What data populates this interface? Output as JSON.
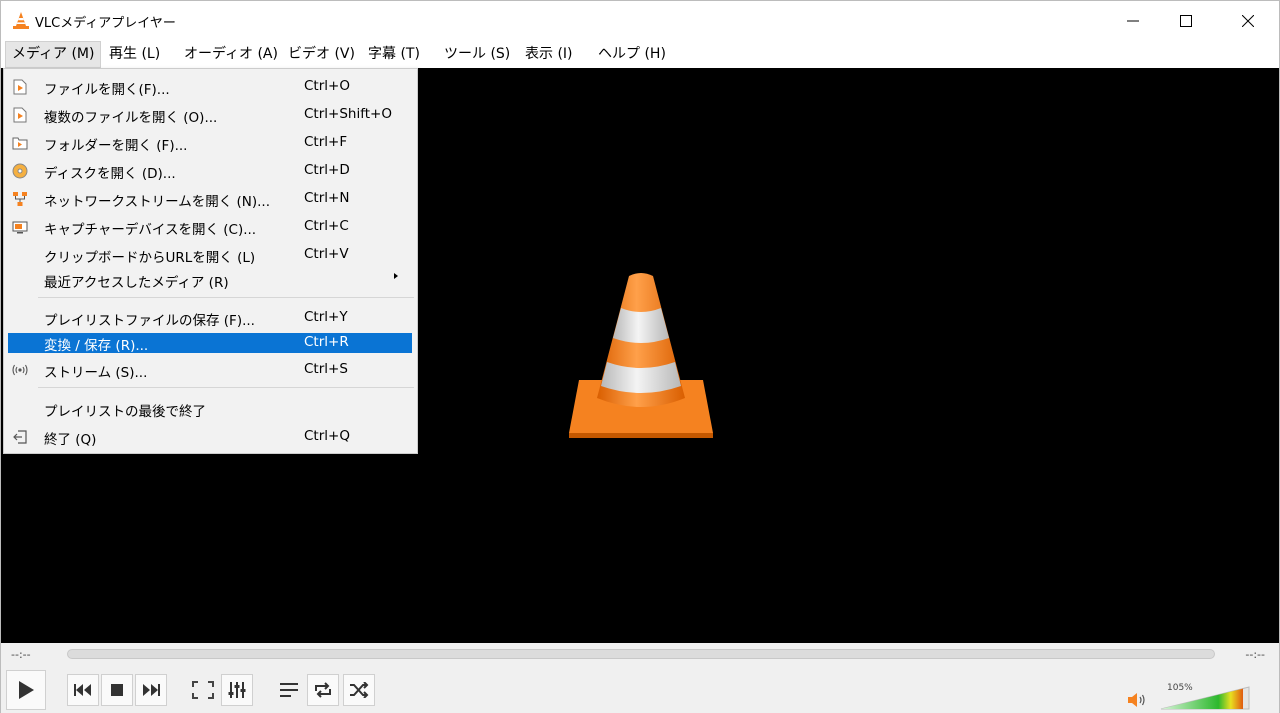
{
  "window": {
    "title": "VLCメディアプレイヤー"
  },
  "menubar": {
    "items": [
      {
        "label": "メディア (M)"
      },
      {
        "label": "再生 (L)"
      },
      {
        "label": "オーディオ (A)"
      },
      {
        "label": "ビデオ (V)"
      },
      {
        "label": "字幕 (T)"
      },
      {
        "label": "ツール (S)"
      },
      {
        "label": "表示 (I)"
      },
      {
        "label": "ヘルプ (H)"
      }
    ]
  },
  "media_menu": {
    "items": [
      {
        "label": "ファイルを開く(F)...",
        "shortcut": "Ctrl+O",
        "icon": "file-open-icon"
      },
      {
        "label": "複数のファイルを開く (O)...",
        "shortcut": "Ctrl+Shift+O",
        "icon": "multiple-files-icon"
      },
      {
        "label": "フォルダーを開く (F)...",
        "shortcut": "Ctrl+F",
        "icon": "folder-icon"
      },
      {
        "label": "ディスクを開く (D)...",
        "shortcut": "Ctrl+D",
        "icon": "disc-icon"
      },
      {
        "label": "ネットワークストリームを開く (N)...",
        "shortcut": "Ctrl+N",
        "icon": "network-icon"
      },
      {
        "label": "キャプチャーデバイスを開く (C)...",
        "shortcut": "Ctrl+C",
        "icon": "capture-device-icon"
      },
      {
        "label": "クリップボードからURLを開く (L)",
        "shortcut": "Ctrl+V",
        "icon": ""
      },
      {
        "label": "最近アクセスしたメディア (R)",
        "shortcut": "",
        "icon": ""
      },
      {
        "label": "プレイリストファイルの保存 (F)...",
        "shortcut": "Ctrl+Y",
        "icon": ""
      },
      {
        "label": "変換 / 保存 (R)...",
        "shortcut": "Ctrl+R",
        "icon": ""
      },
      {
        "label": "ストリーム (S)...",
        "shortcut": "Ctrl+S",
        "icon": "stream-icon"
      },
      {
        "label": "プレイリストの最後で終了",
        "shortcut": "",
        "icon": ""
      },
      {
        "label": "終了 (Q)",
        "shortcut": "Ctrl+Q",
        "icon": "exit-icon"
      }
    ],
    "highlighted": "変換 / 保存 (R)..."
  },
  "controls": {
    "elapsed": "--:--",
    "remaining": "--:--",
    "volume_label": "105%",
    "volume_level": 1.05
  },
  "colors": {
    "highlight": "#0a74d4",
    "video_bg": "#000000",
    "cone_orange": "#f58220",
    "volume_green": "#2db82d"
  }
}
